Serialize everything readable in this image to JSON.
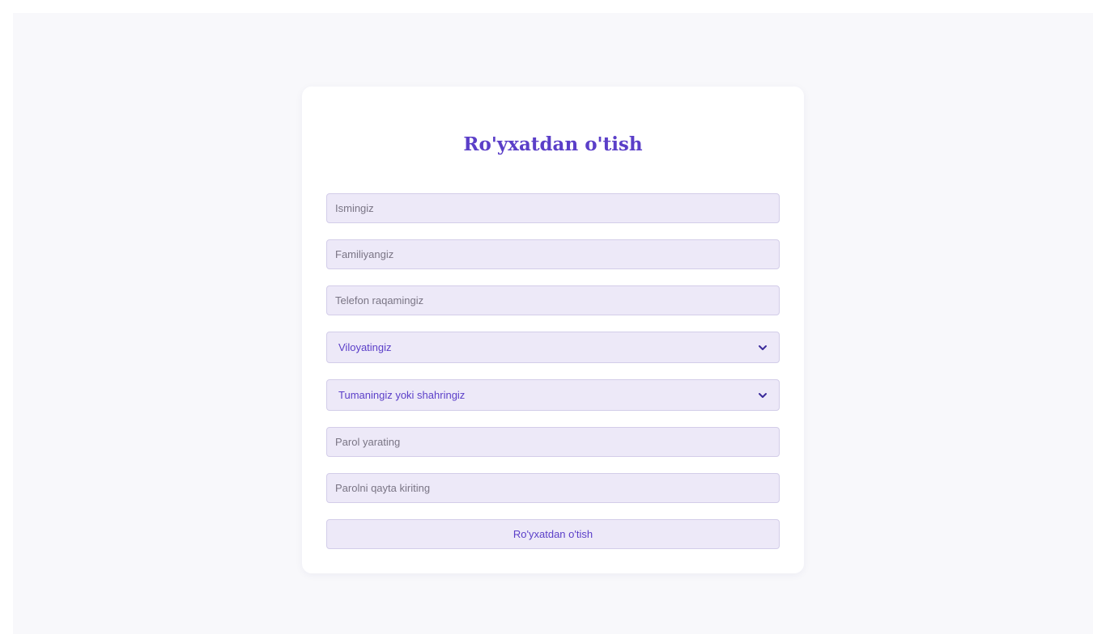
{
  "form": {
    "title": "Ro'yxatdan o'tish",
    "first_name_placeholder": "Ismingiz",
    "last_name_placeholder": "Familiyangiz",
    "phone_placeholder": "Telefon raqamingiz",
    "region_selected": "Viloyatingiz",
    "district_selected": "Tumaningiz yoki shahringiz",
    "password_placeholder": "Parol yarating",
    "password_confirm_placeholder": "Parolni qayta kiriting",
    "submit_label": "Ro'yxatdan o'tish"
  },
  "colors": {
    "accent": "#5b3fc8",
    "field_bg": "#ede9f8",
    "page_bg": "#f8f8fb"
  },
  "icons": {
    "select_arrow": "chevron-down-icon"
  }
}
